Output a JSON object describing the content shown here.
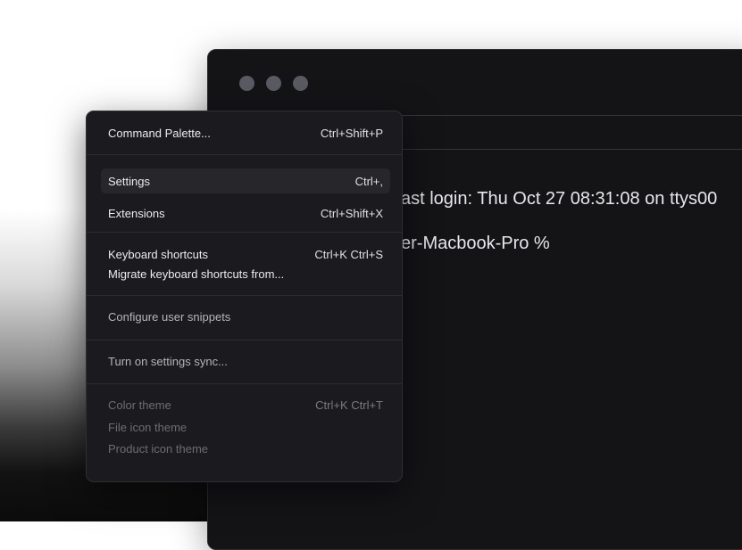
{
  "terminal": {
    "line1": "ast login: Thu Oct 27 08:31:08 on ttys00",
    "line2": "er-Macbook-Pro %"
  },
  "menu": {
    "command_palette": {
      "label": "Command Palette...",
      "shortcut": "Ctrl+Shift+P"
    },
    "settings": {
      "label": "Settings",
      "shortcut": "Ctrl+,"
    },
    "extensions": {
      "label": "Extensions",
      "shortcut": "Ctrl+Shift+X"
    },
    "keyboard_shortcuts": {
      "label": "Keyboard shortcuts",
      "shortcut": "Ctrl+K Ctrl+S"
    },
    "migrate_shortcuts": {
      "label": "Migrate keyboard shortcuts from..."
    },
    "user_snippets": {
      "label": "Configure user snippets"
    },
    "settings_sync": {
      "label": "Turn on settings sync..."
    },
    "color_theme": {
      "label": "Color theme",
      "shortcut": "Ctrl+K Ctrl+T"
    },
    "file_icon_theme": {
      "label": "File icon theme"
    },
    "product_icon_theme": {
      "label": "Product icon theme"
    }
  },
  "colors": {
    "menu_bg": "#1b1b1f",
    "terminal_bg": "#141417",
    "window_dot": "#5a5a63",
    "text": "#ececf0"
  }
}
